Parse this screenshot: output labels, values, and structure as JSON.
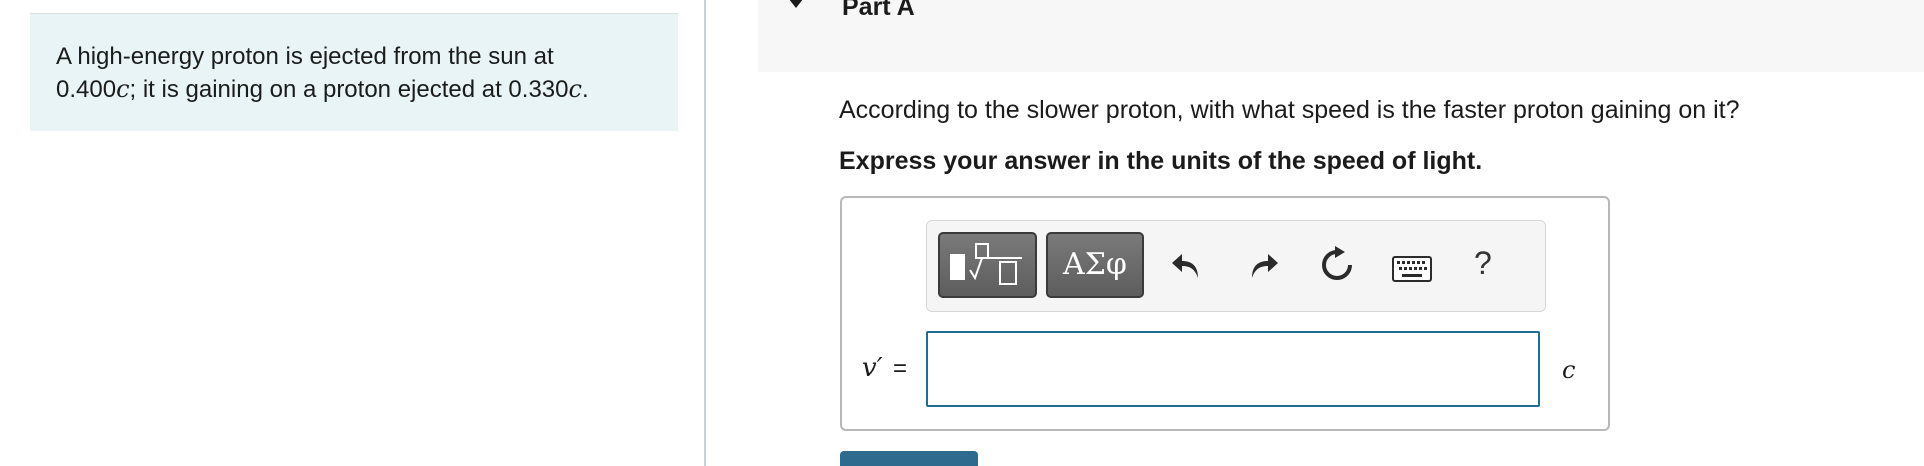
{
  "problem": {
    "part1": "A high-energy proton is ejected from the sun at",
    "speed1_num": "0.400",
    "unit_c": "c",
    "part2": "; it is gaining on a proton ejected at 0.330",
    "end": "."
  },
  "part": {
    "title": "Part A"
  },
  "question": {
    "text": "According to the slower proton, with what speed is the faster proton gaining on it?",
    "instruction": "Express your answer in the units of the speed of light."
  },
  "toolbar": {
    "templates_icon": "templates-icon",
    "symbols_label": "ΑΣφ",
    "undo_icon": "undo-icon",
    "redo_icon": "redo-icon",
    "reset_icon": "reset-icon",
    "keyboard_icon": "keyboard-icon",
    "help_label": "?"
  },
  "answer": {
    "variable": "v′",
    "equals": "=",
    "value": "",
    "unit": "c"
  },
  "colors": {
    "problem_bg": "#e9f4f6",
    "accent": "#1f6e8f",
    "button_dark": "#5d5d5d",
    "submit": "#2e6a8e"
  }
}
